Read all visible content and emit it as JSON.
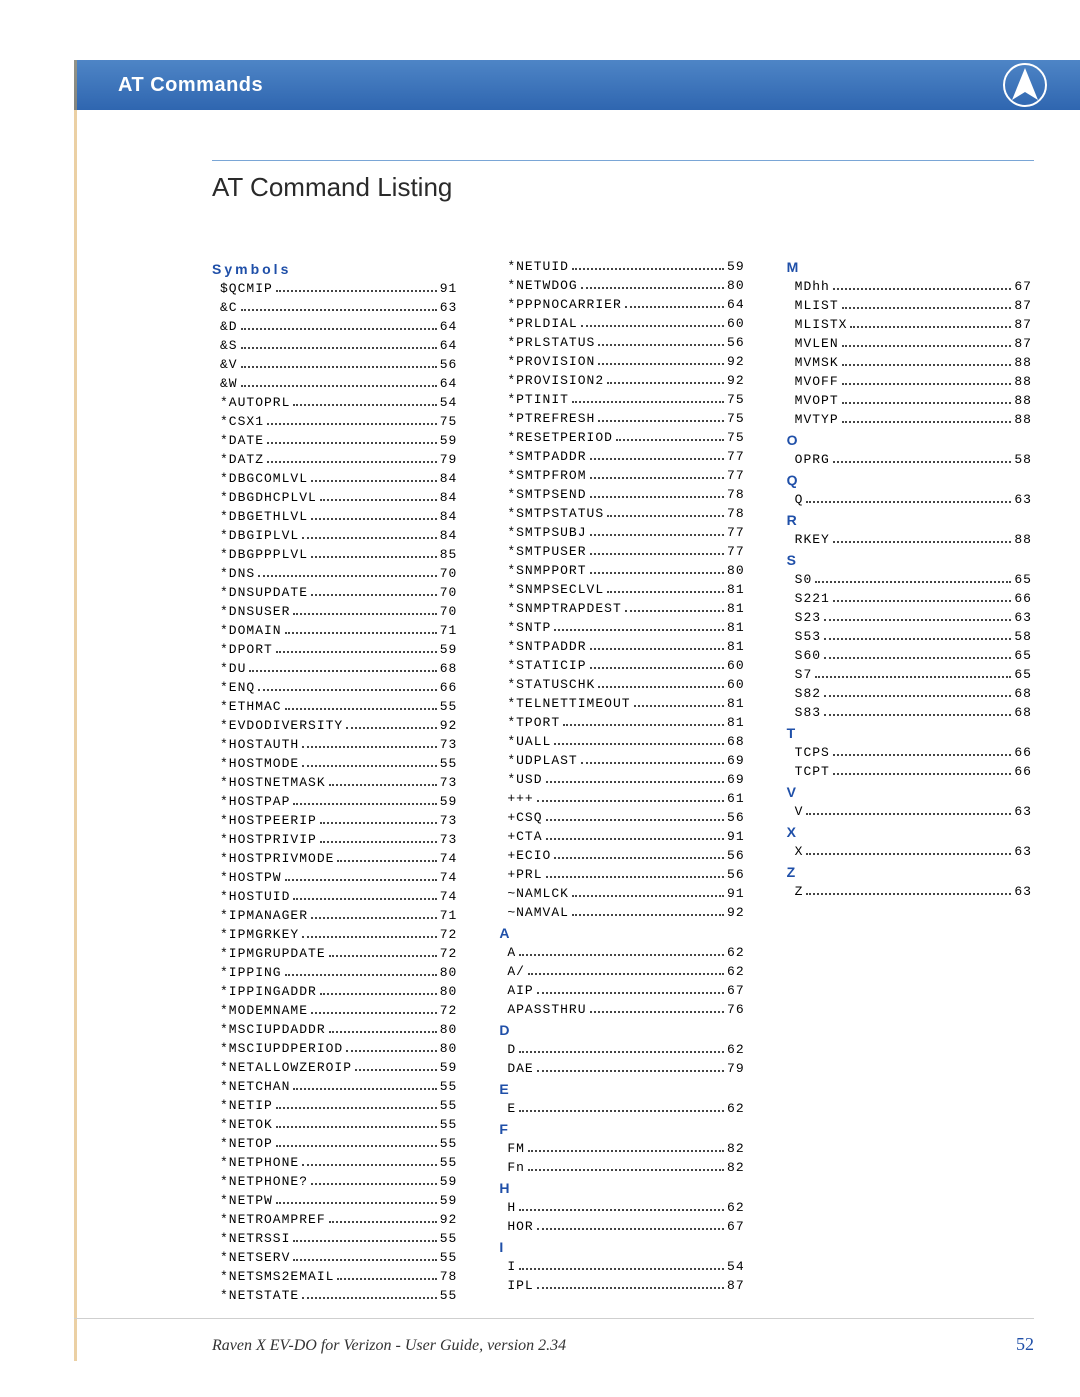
{
  "header": {
    "section": "AT Commands"
  },
  "title": "AT Command Listing",
  "footer": {
    "text": "Raven X EV-DO for Verizon - User Guide, version 2.34",
    "page": "52"
  },
  "index": [
    {
      "head": "Symbols"
    },
    {
      "e": [
        "$QCMIP",
        "91"
      ]
    },
    {
      "e": [
        "&C",
        "63"
      ]
    },
    {
      "e": [
        "&D",
        "64"
      ]
    },
    {
      "e": [
        "&S",
        "64"
      ]
    },
    {
      "e": [
        "&V",
        "56"
      ]
    },
    {
      "e": [
        "&W",
        "64"
      ]
    },
    {
      "e": [
        "*AUTOPRL",
        "54"
      ]
    },
    {
      "e": [
        "*CSX1",
        "75"
      ]
    },
    {
      "e": [
        "*DATE",
        "59"
      ]
    },
    {
      "e": [
        "*DATZ",
        "79"
      ]
    },
    {
      "e": [
        "*DBGCOMLVL",
        "84"
      ]
    },
    {
      "e": [
        "*DBGDHCPLVL",
        "84"
      ]
    },
    {
      "e": [
        "*DBGETHLVL",
        "84"
      ]
    },
    {
      "e": [
        "*DBGIPLVL",
        "84"
      ]
    },
    {
      "e": [
        "*DBGPPPLVL",
        "85"
      ]
    },
    {
      "e": [
        "*DNS",
        "70"
      ]
    },
    {
      "e": [
        "*DNSUPDATE",
        "70"
      ]
    },
    {
      "e": [
        "*DNSUSER",
        "70"
      ]
    },
    {
      "e": [
        "*DOMAIN",
        "71"
      ]
    },
    {
      "e": [
        "*DPORT",
        "59"
      ]
    },
    {
      "e": [
        "*DU",
        "68"
      ]
    },
    {
      "e": [
        "*ENQ",
        "66"
      ]
    },
    {
      "e": [
        "*ETHMAC",
        "55"
      ]
    },
    {
      "e": [
        "*EVDODIVERSITY",
        "92"
      ]
    },
    {
      "e": [
        "*HOSTAUTH",
        "73"
      ]
    },
    {
      "e": [
        "*HOSTMODE",
        "55"
      ]
    },
    {
      "e": [
        "*HOSTNETMASK",
        "73"
      ]
    },
    {
      "e": [
        "*HOSTPAP",
        "59"
      ]
    },
    {
      "e": [
        "*HOSTPEERIP",
        "73"
      ]
    },
    {
      "e": [
        "*HOSTPRIVIP",
        "73"
      ]
    },
    {
      "e": [
        "*HOSTPRIVMODE",
        "74"
      ]
    },
    {
      "e": [
        "*HOSTPW",
        "74"
      ]
    },
    {
      "e": [
        "*HOSTUID",
        "74"
      ]
    },
    {
      "e": [
        "*IPMANAGER",
        "71"
      ]
    },
    {
      "e": [
        "*IPMGRKEY",
        "72"
      ]
    },
    {
      "e": [
        "*IPMGRUPDATE",
        "72"
      ]
    },
    {
      "e": [
        "*IPPING",
        "80"
      ]
    },
    {
      "e": [
        "*IPPINGADDR",
        "80"
      ]
    },
    {
      "e": [
        "*MODEMNAME",
        "72"
      ]
    },
    {
      "e": [
        "*MSCIUPDADDR",
        "80"
      ]
    },
    {
      "e": [
        "*MSCIUPDPERIOD",
        "80"
      ]
    },
    {
      "e": [
        "*NETALLOWZEROIP",
        "59"
      ]
    },
    {
      "e": [
        "*NETCHAN",
        "55"
      ]
    },
    {
      "e": [
        "*NETIP",
        "55"
      ]
    },
    {
      "e": [
        "*NETOK",
        "55"
      ]
    },
    {
      "e": [
        "*NETOP",
        "55"
      ]
    },
    {
      "e": [
        "*NETPHONE",
        "55"
      ]
    },
    {
      "e": [
        "*NETPHONE?",
        "59"
      ]
    },
    {
      "e": [
        "*NETPW",
        "59"
      ]
    },
    {
      "e": [
        "*NETROAMPREF",
        "92"
      ]
    },
    {
      "e": [
        "*NETRSSI",
        "55"
      ]
    },
    {
      "e": [
        "*NETSERV",
        "55"
      ]
    },
    {
      "e": [
        "*NETSMS2EMAIL",
        "78"
      ]
    },
    {
      "e": [
        "*NETSTATE",
        "55"
      ]
    },
    {
      "e": [
        "*NETUID",
        "59"
      ]
    },
    {
      "e": [
        "*NETWDOG",
        "80"
      ]
    },
    {
      "e": [
        "*PPPNOCARRIER",
        "64"
      ]
    },
    {
      "e": [
        "*PRLDIAL",
        "60"
      ]
    },
    {
      "e": [
        "*PRLSTATUS",
        "56"
      ]
    },
    {
      "e": [
        "*PROVISION",
        "92"
      ]
    },
    {
      "e": [
        "*PROVISION2",
        "92"
      ]
    },
    {
      "e": [
        "*PTINIT",
        "75"
      ]
    },
    {
      "e": [
        "*PTREFRESH",
        "75"
      ]
    },
    {
      "e": [
        "*RESETPERIOD",
        "75"
      ]
    },
    {
      "e": [
        "*SMTPADDR",
        "77"
      ]
    },
    {
      "e": [
        "*SMTPFROM",
        "77"
      ]
    },
    {
      "e": [
        "*SMTPSEND",
        "78"
      ]
    },
    {
      "e": [
        "*SMTPSTATUS",
        "78"
      ]
    },
    {
      "e": [
        "*SMTPSUBJ",
        "77"
      ]
    },
    {
      "e": [
        "*SMTPUSER",
        "77"
      ]
    },
    {
      "e": [
        "*SNMPPORT",
        "80"
      ]
    },
    {
      "e": [
        "*SNMPSECLVL",
        "81"
      ]
    },
    {
      "e": [
        "*SNMPTRAPDEST",
        "81"
      ]
    },
    {
      "e": [
        "*SNTP",
        "81"
      ]
    },
    {
      "e": [
        "*SNTPADDR",
        "81"
      ]
    },
    {
      "e": [
        "*STATICIP",
        "60"
      ]
    },
    {
      "e": [
        "*STATUSCHK",
        "60"
      ]
    },
    {
      "e": [
        "*TELNETTIMEOUT",
        "81"
      ]
    },
    {
      "e": [
        "*TPORT",
        "81"
      ]
    },
    {
      "e": [
        "*UALL",
        "68"
      ]
    },
    {
      "e": [
        "*UDPLAST",
        "69"
      ]
    },
    {
      "e": [
        "*USD",
        "69"
      ]
    },
    {
      "e": [
        "+++",
        "61"
      ]
    },
    {
      "e": [
        "+CSQ",
        "56"
      ]
    },
    {
      "e": [
        "+CTA",
        "91"
      ]
    },
    {
      "e": [
        "+ECIO",
        "56"
      ]
    },
    {
      "e": [
        "+PRL",
        "56"
      ]
    },
    {
      "e": [
        "~NAMLCK",
        "91"
      ]
    },
    {
      "e": [
        "~NAMVAL",
        "92"
      ]
    },
    {
      "head": "A",
      "alpha": true
    },
    {
      "e": [
        "A",
        "62"
      ]
    },
    {
      "e": [
        "A/",
        "62"
      ]
    },
    {
      "e": [
        "AIP",
        "67"
      ]
    },
    {
      "e": [
        "APASSTHRU",
        "76"
      ]
    },
    {
      "head": "D",
      "alpha": true
    },
    {
      "e": [
        "D",
        "62"
      ]
    },
    {
      "e": [
        "DAE",
        "79"
      ]
    },
    {
      "head": "E",
      "alpha": true
    },
    {
      "e": [
        "E",
        "62"
      ]
    },
    {
      "head": "F",
      "alpha": true
    },
    {
      "e": [
        "FM",
        "82"
      ]
    },
    {
      "e": [
        "Fn",
        "82"
      ]
    },
    {
      "head": "H",
      "alpha": true
    },
    {
      "e": [
        "H",
        "62"
      ]
    },
    {
      "e": [
        "HOR",
        "67"
      ]
    },
    {
      "head": "I",
      "alpha": true
    },
    {
      "e": [
        "I",
        "54"
      ]
    },
    {
      "e": [
        "IPL",
        "87"
      ]
    },
    {
      "head": "M",
      "alpha": true
    },
    {
      "e": [
        "MDhh",
        "67"
      ]
    },
    {
      "e": [
        "MLIST",
        "87"
      ]
    },
    {
      "e": [
        "MLISTX",
        "87"
      ]
    },
    {
      "e": [
        "MVLEN",
        "87"
      ]
    },
    {
      "e": [
        "MVMSK",
        "88"
      ]
    },
    {
      "e": [
        "MVOFF",
        "88"
      ]
    },
    {
      "e": [
        "MVOPT",
        "88"
      ]
    },
    {
      "e": [
        "MVTYP",
        "88"
      ]
    },
    {
      "head": "O",
      "alpha": true
    },
    {
      "e": [
        "OPRG",
        "58"
      ]
    },
    {
      "head": "Q",
      "alpha": true
    },
    {
      "e": [
        "Q",
        "63"
      ]
    },
    {
      "head": "R",
      "alpha": true
    },
    {
      "e": [
        "RKEY",
        "88"
      ]
    },
    {
      "head": "S",
      "alpha": true
    },
    {
      "e": [
        "S0",
        "65"
      ]
    },
    {
      "e": [
        "S221",
        "66"
      ]
    },
    {
      "e": [
        "S23",
        "63"
      ]
    },
    {
      "e": [
        "S53",
        "58"
      ]
    },
    {
      "e": [
        "S60",
        "65"
      ]
    },
    {
      "e": [
        "S7",
        "65"
      ]
    },
    {
      "e": [
        "S82",
        "68"
      ]
    },
    {
      "e": [
        "S83",
        "68"
      ]
    },
    {
      "head": "T",
      "alpha": true
    },
    {
      "e": [
        "TCPS",
        "66"
      ]
    },
    {
      "e": [
        "TCPT",
        "66"
      ]
    },
    {
      "head": "V",
      "alpha": true
    },
    {
      "e": [
        "V",
        "63"
      ]
    },
    {
      "head": "X",
      "alpha": true
    },
    {
      "e": [
        "X",
        "63"
      ]
    },
    {
      "head": "Z",
      "alpha": true
    },
    {
      "e": [
        "Z",
        "63"
      ]
    }
  ]
}
